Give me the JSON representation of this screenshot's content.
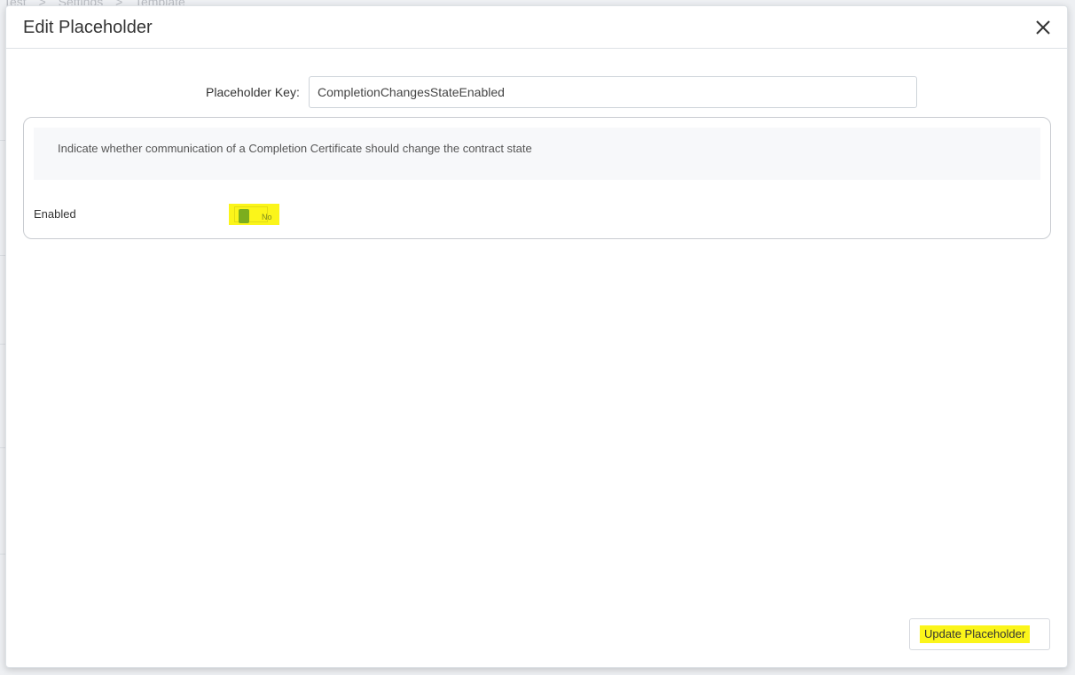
{
  "background": {
    "breadcrumb": [
      "Test",
      ">",
      "Settings",
      ">",
      "Template"
    ]
  },
  "modal": {
    "title": "Edit Placeholder",
    "close_icon": "close-icon",
    "placeholder_key": {
      "label": "Placeholder Key:",
      "value": "CompletionChangesStateEnabled"
    },
    "setting": {
      "description": "Indicate whether communication of a Completion Certificate should change the contract state",
      "enabled_label": "Enabled",
      "toggle": {
        "state_text": "No",
        "checked": false
      }
    },
    "update_button_label": "Update Placeholder"
  },
  "colors": {
    "highlight": "#fbf51a",
    "toggle_knob": "#7cad1e",
    "border": "#dee2e6"
  }
}
